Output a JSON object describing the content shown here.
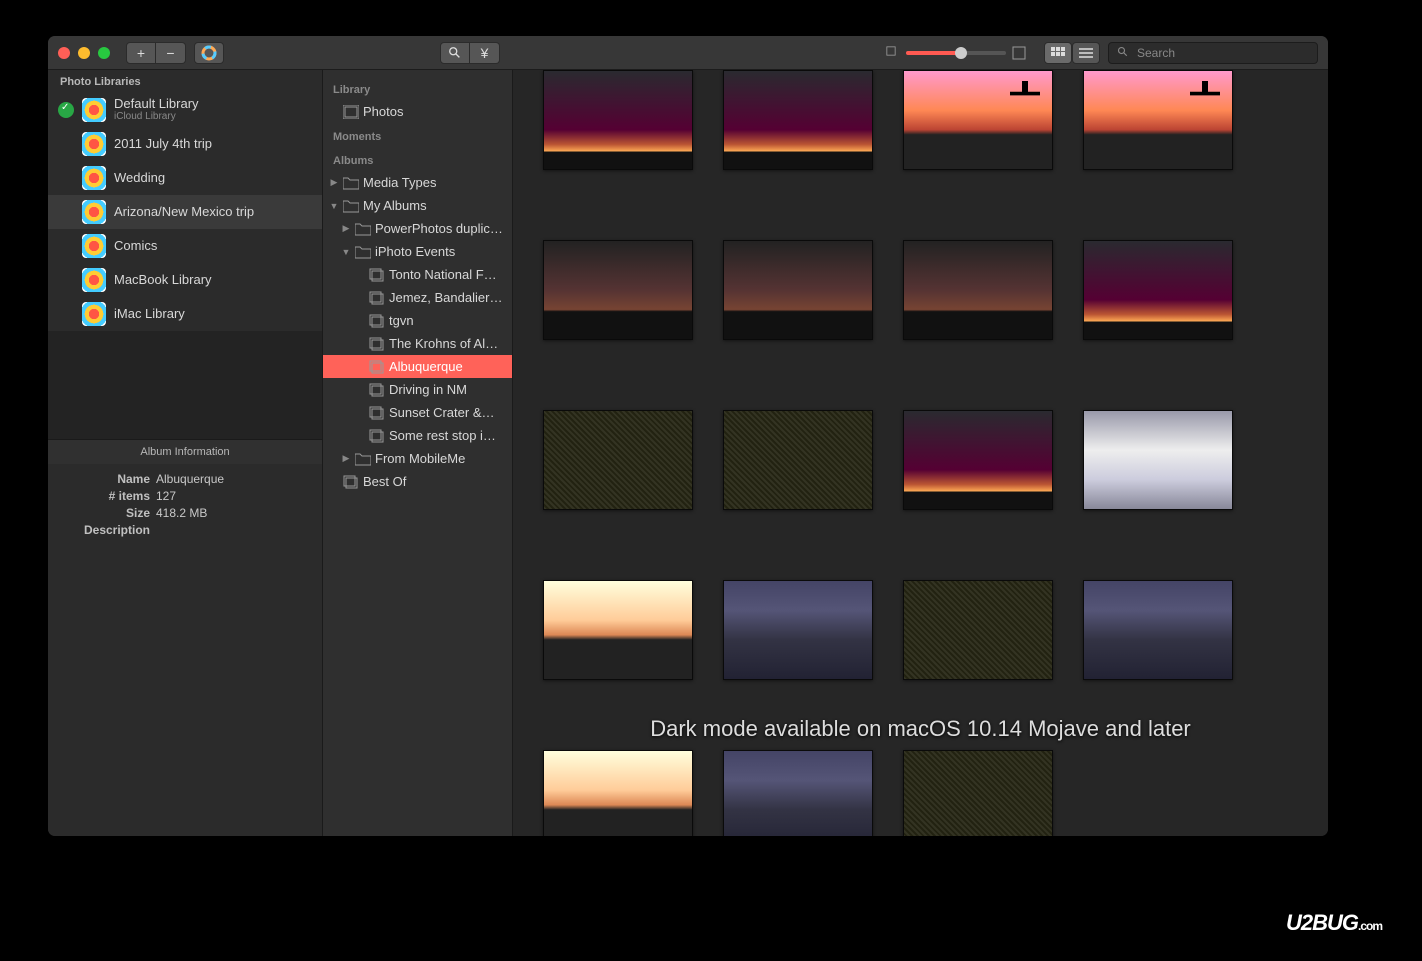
{
  "toolbar": {
    "search_placeholder": "Search"
  },
  "sidebar": {
    "header": "Photo Libraries",
    "libraries": [
      {
        "name": "Default Library",
        "sub": "iCloud Library",
        "checked": true,
        "selected": false
      },
      {
        "name": "2011 July 4th trip",
        "sub": "",
        "checked": false,
        "selected": false
      },
      {
        "name": "Wedding",
        "sub": "",
        "checked": false,
        "selected": false
      },
      {
        "name": "Arizona/New Mexico trip",
        "sub": "",
        "checked": false,
        "selected": true
      },
      {
        "name": "Comics",
        "sub": "",
        "checked": false,
        "selected": false
      },
      {
        "name": "MacBook Library",
        "sub": "",
        "checked": false,
        "selected": false
      },
      {
        "name": "iMac Library",
        "sub": "",
        "checked": false,
        "selected": false
      }
    ],
    "info_title": "Album Information",
    "info": {
      "name_label": "Name",
      "name_value": "Albuquerque",
      "items_label": "# items",
      "items_value": "127",
      "size_label": "Size",
      "size_value": "418.2 MB",
      "desc_label": "Description",
      "desc_value": ""
    }
  },
  "tree": {
    "cats": {
      "library": "Library",
      "moments": "Moments",
      "albums": "Albums"
    },
    "library_items": [
      {
        "label": "Photos"
      }
    ],
    "albums": [
      {
        "label": "Media Types",
        "indent": 0,
        "disclosure": "▶",
        "type": "folder"
      },
      {
        "label": "My Albums",
        "indent": 0,
        "disclosure": "▼",
        "type": "folder"
      },
      {
        "label": "PowerPhotos duplic…",
        "indent": 1,
        "disclosure": "▶",
        "type": "folder"
      },
      {
        "label": "iPhoto Events",
        "indent": 1,
        "disclosure": "▼",
        "type": "folder"
      },
      {
        "label": "Tonto National F…",
        "indent": 2,
        "disclosure": "",
        "type": "album"
      },
      {
        "label": "Jemez, Bandalier…",
        "indent": 2,
        "disclosure": "",
        "type": "album"
      },
      {
        "label": "tgvn",
        "indent": 2,
        "disclosure": "",
        "type": "album"
      },
      {
        "label": "The Krohns of Al…",
        "indent": 2,
        "disclosure": "",
        "type": "album"
      },
      {
        "label": "Albuquerque",
        "indent": 2,
        "disclosure": "",
        "type": "album",
        "selected": true
      },
      {
        "label": "Driving in NM",
        "indent": 2,
        "disclosure": "",
        "type": "album"
      },
      {
        "label": "Sunset Crater &…",
        "indent": 2,
        "disclosure": "",
        "type": "album"
      },
      {
        "label": "Some rest stop i…",
        "indent": 2,
        "disclosure": "",
        "type": "album"
      },
      {
        "label": "From MobileMe",
        "indent": 1,
        "disclosure": "▶",
        "type": "folder"
      },
      {
        "label": "Best Of",
        "indent": 0,
        "disclosure": "",
        "type": "album"
      }
    ]
  },
  "caption": "Dark mode available on macOS 10.14 Mojave and later",
  "watermark": "U2BUG",
  "watermark_suffix": ".com"
}
